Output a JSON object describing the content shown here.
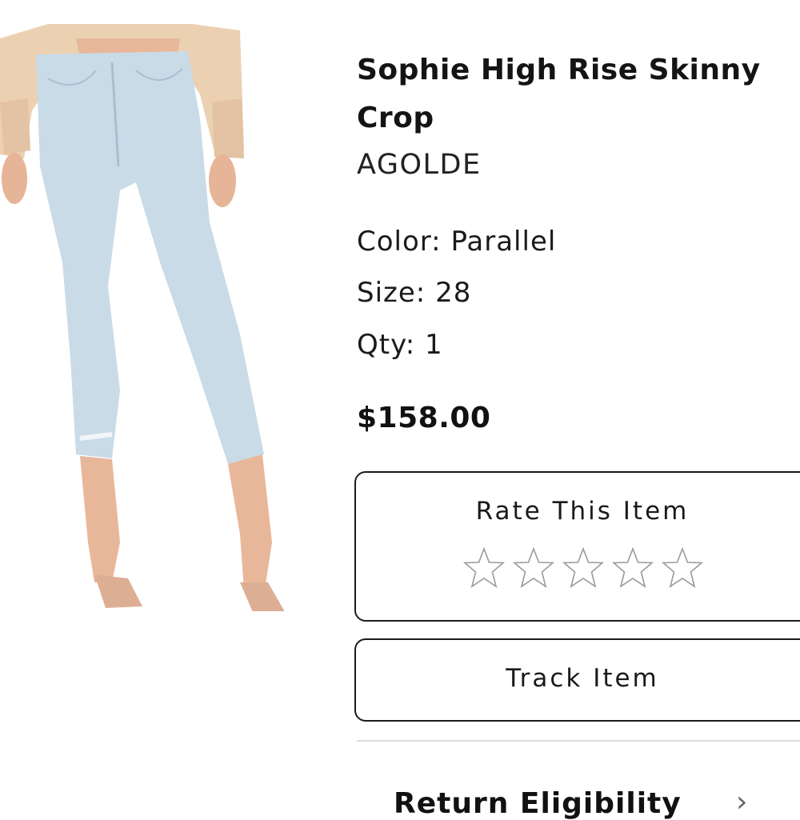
{
  "product": {
    "title": "Sophie High Rise Skinny Crop",
    "brand": "AGOLDE",
    "color_label": "Color: ",
    "color_value": "Parallel",
    "size_label": "Size: ",
    "size_value": "28",
    "qty_label": "Qty: ",
    "qty_value": "1",
    "price": "$158.00"
  },
  "rating": {
    "title": "Rate This Item",
    "max_stars": 5,
    "current": 0
  },
  "track": {
    "label": "Track Item"
  },
  "below_fold": {
    "partial_label": "Return Eligibility",
    "arrow": "›"
  },
  "colors": {
    "border": "#1c1c1c",
    "star_outline": "#9a9a9a",
    "divider": "#dcdcdc",
    "denim": "#c9dbe7"
  }
}
